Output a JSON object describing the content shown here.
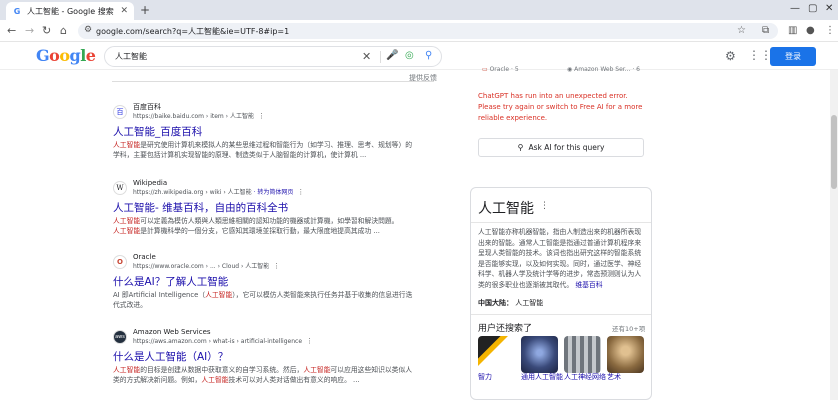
{
  "browser": {
    "tab_title": "人工智能 - Google 搜索",
    "tab_favicon": "G",
    "tab_close": "✕",
    "new_tab": "+",
    "url": "google.com/search?q=人工智能&ie=UTF-8#ip=1"
  },
  "header": {
    "logo": "Google",
    "query": "人工智能",
    "login_label": "登录"
  },
  "feedback_label": "提供反馈",
  "results": [
    {
      "favicon": "百",
      "site": "百度百科",
      "url": "https://baike.baidu.com › item › 人工智能",
      "url_translate": "",
      "title": "人工智能_百度百科",
      "snippet_parts": [
        {
          "text": "人工智能",
          "hl": true
        },
        {
          "text": "是研究使用计算机来模拟人的某些思维过程和智能行为（如学习、推理、思考、规划等）的学科，主要包括计算机实现智能的原理、制造类似于人脑智能的计算机，使计算机 ...",
          "hl": false
        }
      ]
    },
    {
      "favicon": "W",
      "site": "Wikipedia",
      "url": "https://zh.wikipedia.org › wiki › 人工智能",
      "url_translate": " · 转为简体网页",
      "title": "人工智能- 维基百科，自由的百科全书",
      "snippet_parts": [
        {
          "text": "人工智能",
          "hl": true
        },
        {
          "text": "可以定義為模仿人類與人類思維相關的認知功能的機器或計算機，如學習和解決問題。",
          "hl": false
        },
        {
          "text": "人工智能",
          "hl": true
        },
        {
          "text": "是計算機科學的一個分支，它感知其環境並採取行動，最大限度地提高其成功 ...",
          "hl": false
        }
      ]
    },
    {
      "favicon": "O",
      "site": "Oracle",
      "url": "https://www.oracle.com › ... › Cloud › 人工智能",
      "url_translate": "",
      "title": "什么是AI？了解人工智能",
      "snippet_parts": [
        {
          "text": "AI 即Artificial Intelligence（",
          "hl": false
        },
        {
          "text": "人工智能",
          "hl": true
        },
        {
          "text": "），它可以模仿人类智能来执行任务并基于收集的信息进行迭代式改进。",
          "hl": false
        }
      ]
    },
    {
      "favicon": "aws",
      "site": "Amazon Web Services",
      "url": "https://aws.amazon.com › what-is › artificial-intelligence",
      "url_translate": "",
      "title": "什么是人工智能（AI）？",
      "snippet_parts": [
        {
          "text": "人工智能",
          "hl": true
        },
        {
          "text": "的目标是创建从数据中获取意义的自学习系统。然后，",
          "hl": false
        },
        {
          "text": "人工智能",
          "hl": true
        },
        {
          "text": "可以应用这些知识以类似人类的方式解决新问题。例如，",
          "hl": false
        },
        {
          "text": "人工智能",
          "hl": true
        },
        {
          "text": "技术可以对人类对话做出有意义的响应。 ...",
          "hl": false
        }
      ]
    }
  ],
  "ai_panel": {
    "chip1": "Oracle · 5",
    "chip2": "Amazon Web Ser... · 6",
    "error": "ChatGPT has run into an unexpected error. Please try again or switch to Free AI for a more reliable experience.",
    "ask_label": "Ask AI for this query"
  },
  "knowledge": {
    "title": "人工智能",
    "desc": "人工智能亦称机器智能，指由人制造出来的机器所表现出来的智能。通常人工智能是指通过普通计算机程序来呈现人类智能的技术。该词也指出研究这样的智能系统是否能够实现，以及如何实现。同时，通过医学、神经科学、机器人学及统计学等的进步，常态预测则认为人类的很多职业也逐渐被其取代。",
    "desc_link": "维基百科",
    "fact_label": "中国大陆：",
    "fact_value": "人工智能",
    "also_title": "用户还搜索了",
    "also_more": "还有10+项",
    "related": [
      {
        "label": "智力",
        "color": "#e8e8e8"
      },
      {
        "label": "通用人工智能",
        "color": "#3a4a7a"
      },
      {
        "label": "人工神经网络",
        "color": "#9aa0a6"
      },
      {
        "label": "艺术",
        "color": "#b08860"
      }
    ]
  }
}
